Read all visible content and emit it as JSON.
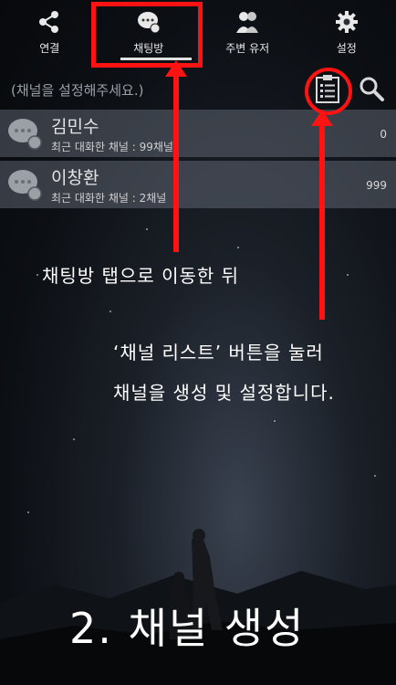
{
  "tabs": [
    {
      "label": "연결",
      "icon": "share-icon"
    },
    {
      "label": "채팅방",
      "icon": "chat-bubble-icon"
    },
    {
      "label": "주변 유저",
      "icon": "users-icon"
    },
    {
      "label": "설정",
      "icon": "gear-icon"
    }
  ],
  "channel_hint": "(채널을 설정해주세요.)",
  "rows": [
    {
      "name": "김민수",
      "sub": "최근 대화한 채널 : 99채널",
      "count": "0"
    },
    {
      "name": "이창환",
      "sub": "최근 대화한 채널 : 2채널",
      "count": "999"
    }
  ],
  "notes": {
    "note1": "채팅방 탭으로 이동한 뒤",
    "note2_line1": "‘채널 리스트’ 버튼을 눌러",
    "note2_line2": "채널을 생성 및 설정합니다.",
    "title": "2. 채널 생성"
  },
  "colors": {
    "annotation": "#ff1212"
  }
}
